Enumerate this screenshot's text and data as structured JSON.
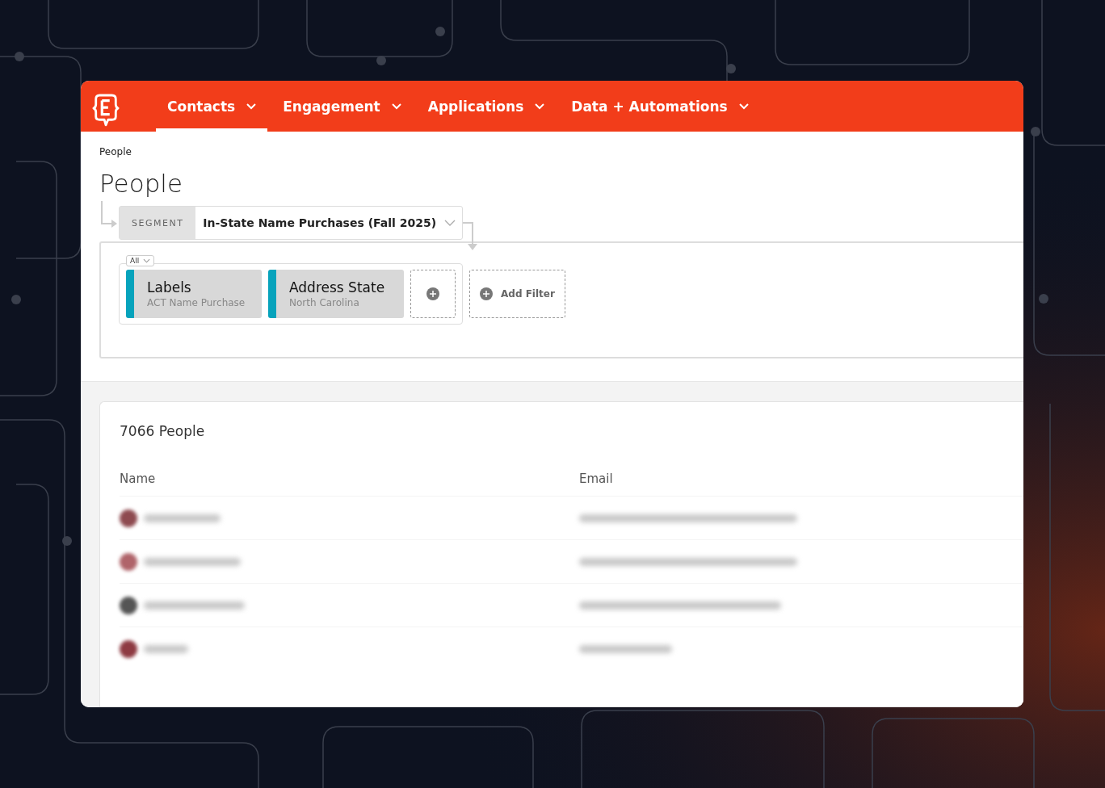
{
  "nav": {
    "tabs": [
      {
        "label": "Contacts",
        "selected": true
      },
      {
        "label": "Engagement",
        "selected": false
      },
      {
        "label": "Applications",
        "selected": false
      },
      {
        "label": "Data + Automations",
        "selected": false
      }
    ]
  },
  "breadcrumb": "People",
  "title": "People",
  "segment": {
    "label": "SEGMENT",
    "value": "In-State Name Purchases (Fall 2025)"
  },
  "filter_group": {
    "match": "All",
    "filters": [
      {
        "name": "Labels",
        "value": "ACT Name Purchase"
      },
      {
        "name": "Address State",
        "value": "North Carolina"
      }
    ],
    "add_filter": "Add Filter"
  },
  "results": {
    "count": "7066 People",
    "columns": [
      "Name",
      "Email"
    ],
    "rows": [
      {
        "kind": "redacted",
        "color": "#8e4a50"
      },
      {
        "kind": "redacted",
        "color": "#b0646a"
      },
      {
        "kind": "redacted",
        "color": "#555555"
      },
      {
        "kind": "redacted",
        "color": "#8e3a42"
      }
    ]
  }
}
